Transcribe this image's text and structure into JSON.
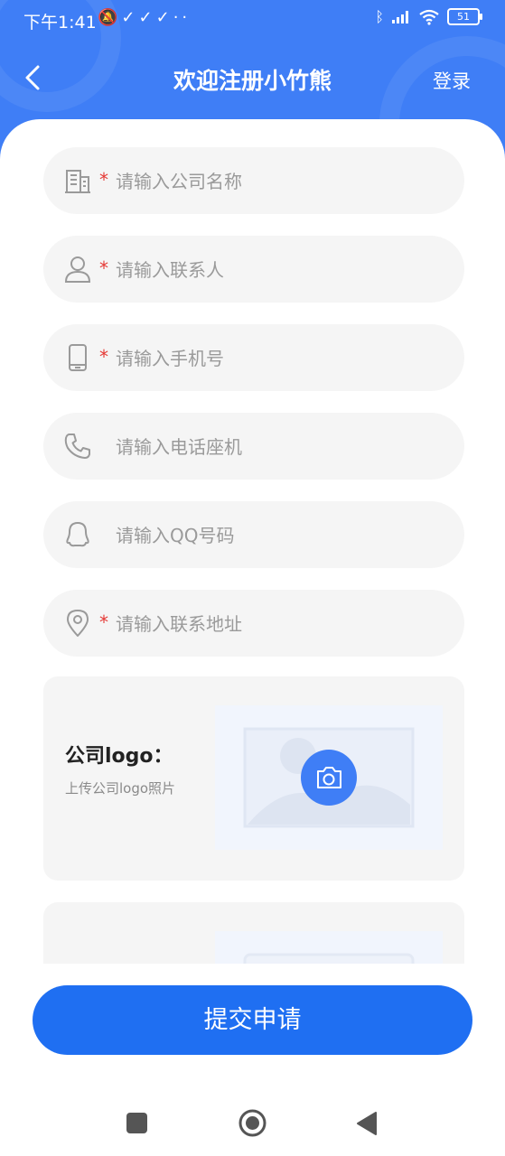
{
  "status_bar": {
    "time": "下午1:41",
    "icons": [
      "mute-alarm-icon",
      "check-icon",
      "check-icon",
      "check-icon",
      "more-dots-icon"
    ],
    "right_icons": [
      "bluetooth-icon",
      "signal-icon",
      "wifi-icon"
    ],
    "battery": "51"
  },
  "header": {
    "title": "欢迎注册小竹熊",
    "login_label": "登录",
    "accent_color": "#3f7ef6"
  },
  "form": {
    "fields": [
      {
        "name": "company",
        "icon": "building-icon",
        "required": "*",
        "placeholder": "请输入公司名称"
      },
      {
        "name": "contact",
        "icon": "person-icon",
        "required": "*",
        "placeholder": "请输入联系人"
      },
      {
        "name": "mobile",
        "icon": "phone-icon",
        "required": "*",
        "placeholder": "请输入手机号"
      },
      {
        "name": "landline",
        "icon": "telephone-icon",
        "required": "",
        "placeholder": "请输入电话座机"
      },
      {
        "name": "qq",
        "icon": "qq-icon",
        "required": "",
        "placeholder": "请输入QQ号码"
      },
      {
        "name": "address",
        "icon": "location-pin-icon",
        "required": "*",
        "placeholder": "请输入联系地址"
      }
    ],
    "logo_upload": {
      "title": "公司logo：",
      "subtitle": "上传公司logo照片",
      "icon": "camera-icon"
    }
  },
  "submit": {
    "label": "提交申请",
    "color": "#1f6ff2"
  },
  "system_nav": [
    "recents-square-icon",
    "home-circle-icon",
    "back-triangle-icon"
  ]
}
